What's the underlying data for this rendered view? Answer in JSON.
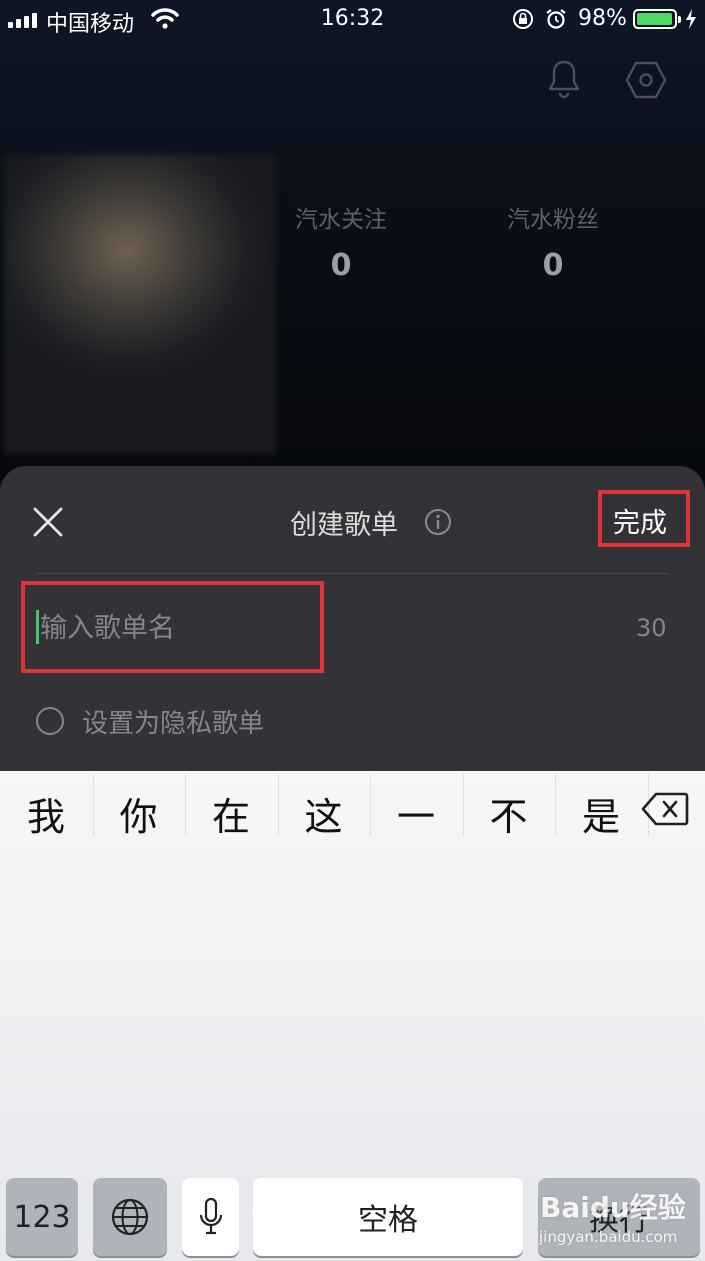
{
  "status_bar": {
    "carrier": "中国移动",
    "time": "16:32",
    "battery_percent": "98%",
    "battery_level": 0.98,
    "icons": [
      "signal-icon",
      "wifi-icon",
      "rotation-lock-icon",
      "alarm-icon",
      "battery-icon",
      "charging-icon"
    ]
  },
  "header": {
    "icons": [
      "bell-icon",
      "settings-icon"
    ]
  },
  "profile": {
    "following_label": "汽水关注",
    "following_count": "0",
    "fans_label": "汽水粉丝",
    "fans_count": "0"
  },
  "dialog": {
    "title": "创建歌单",
    "done_label": "完成",
    "name_placeholder": "输入歌单名",
    "name_value": "",
    "char_limit": "30",
    "private_label": "设置为隐私歌单",
    "private_checked": false
  },
  "keyboard": {
    "candidates": [
      "我",
      "你",
      "在",
      "这",
      "一",
      "不",
      "是"
    ],
    "numbers_key": "123",
    "space_key": "空格",
    "return_key": "换行"
  },
  "watermark": {
    "brand": "Baidu经验",
    "url": "jingyan.baidu.com"
  },
  "colors": {
    "highlight": "#e03434",
    "caret": "#3fc96a",
    "sheet": "#333237",
    "battery_fill": "#4cd964"
  }
}
